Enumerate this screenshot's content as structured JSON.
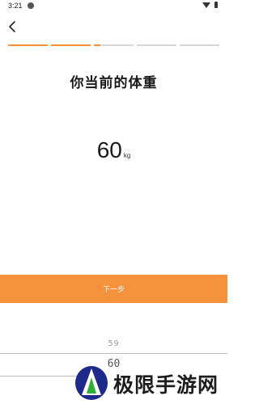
{
  "status_bar": {
    "time": "3:21"
  },
  "header": {
    "back_icon": "back-arrow-icon"
  },
  "progress": {
    "total_steps": 5,
    "completed_steps": 2,
    "current_step_fraction": 0.15,
    "accent_color": "#f5913a",
    "track_color": "#d8d8d8"
  },
  "main": {
    "title": "你当前的体重",
    "weight_value": "60",
    "weight_unit": "kg"
  },
  "actions": {
    "next_label": "下一步",
    "next_color": "#f5913a"
  },
  "picker": {
    "visible_values": [
      "59",
      "60"
    ]
  },
  "watermark": {
    "text": "极限手游网"
  }
}
